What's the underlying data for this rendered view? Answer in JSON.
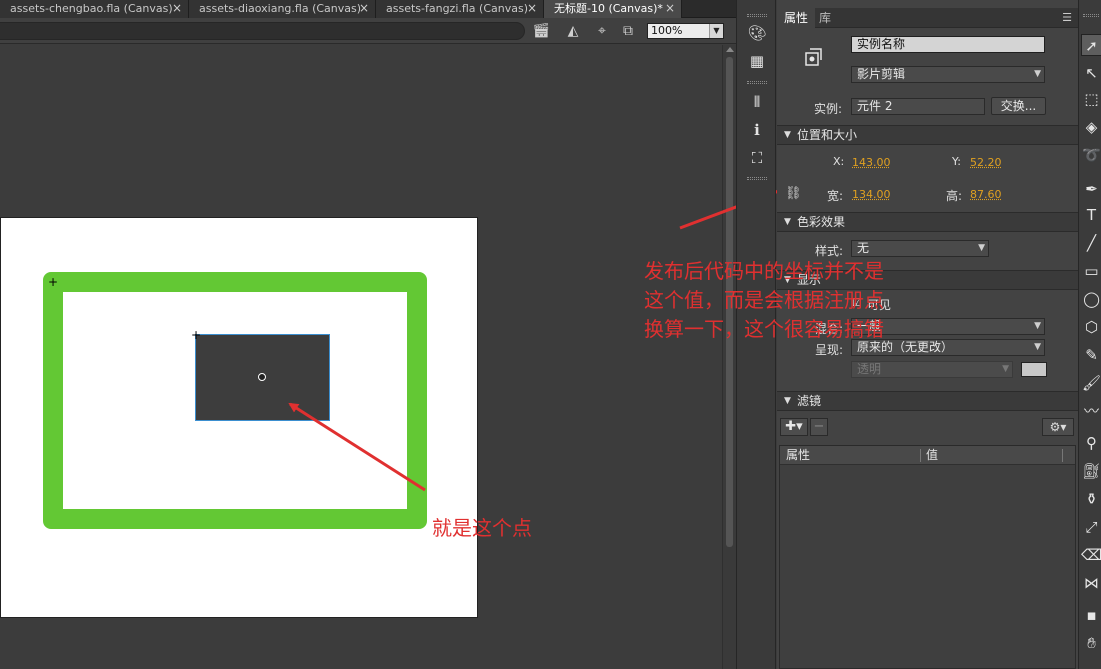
{
  "tabs": [
    {
      "label": "assets-chengbao.fla (Canvas)",
      "close": "×",
      "active": false
    },
    {
      "label": "assets-diaoxiang.fla (Canvas)",
      "close": "×",
      "active": false
    },
    {
      "label": "assets-fangzi.fla (Canvas)",
      "close": "×",
      "active": false
    },
    {
      "label": "无标题-10 (Canvas)*",
      "close": "×",
      "active": true
    }
  ],
  "editbar": {
    "zoom": "100%"
  },
  "annotations": {
    "main_note": [
      "发布后代码中的坐标并不是",
      "这个值，而是会根据注册点",
      "换算一下，这个很容易搞错"
    ],
    "point_note": "就是这个点",
    "color": "#e03030"
  },
  "properties": {
    "tabs": [
      "属性",
      "库"
    ],
    "instance_name_placeholder": "实例名称",
    "symbol_type": "影片剪辑",
    "instance_label": "实例:",
    "instance_value": "元件 2",
    "swap_button": "交换...",
    "sections": {
      "position_size": "位置和大小",
      "color_effect": "色彩效果",
      "display": "显示",
      "filters": "滤镜"
    },
    "x_label": "X:",
    "x_value": "143.00",
    "y_label": "Y:",
    "y_value": "52.20",
    "width_label": "宽:",
    "width_value": "134.00",
    "height_label": "高:",
    "height_value": "87.60",
    "style_label": "样式:",
    "style_value": "无",
    "visible_label": "可见",
    "blend_label": "混合:",
    "blend_value": "一般",
    "render_label": "呈现:",
    "render_value": "原来的（无更改）",
    "transparent_value": "透明",
    "filter_columns": [
      "属性",
      "值"
    ],
    "value_color": "#e0a020"
  },
  "stage": {
    "frame_color": "#63c834"
  }
}
